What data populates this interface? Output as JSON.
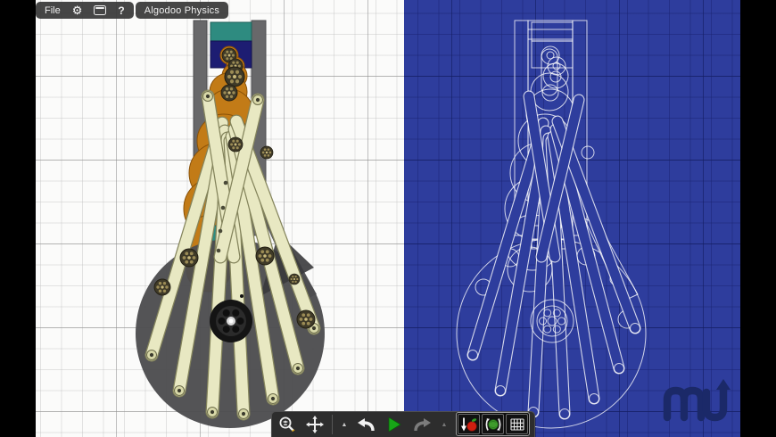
{
  "app": {
    "name": "Algodoo Physics",
    "letterbox_color": "#000000"
  },
  "top_toolbar": {
    "file_label": "File",
    "help_label": "?",
    "title": "Algodoo Physics",
    "icons": [
      {
        "name": "gear-icon",
        "meaning": "settings"
      },
      {
        "name": "window-icon",
        "meaning": "window / display options"
      }
    ]
  },
  "bottom_toolbar": {
    "tools": [
      {
        "name": "zoom-tool",
        "glyph": "magnifier-with-plus"
      },
      {
        "name": "pan-tool",
        "glyph": "four-way-arrows"
      },
      {
        "name": "undo-history",
        "glyph": "small-up-triangle",
        "enabled": true
      },
      {
        "name": "undo",
        "glyph": "curved-arrow-left",
        "enabled": true
      },
      {
        "name": "play",
        "glyph": "green-play-triangle",
        "enabled": true
      },
      {
        "name": "redo",
        "glyph": "curved-arrow-right",
        "enabled": false
      },
      {
        "name": "redo-history",
        "glyph": "small-up-triangle",
        "enabled": false
      }
    ],
    "toggles": [
      {
        "name": "gravity-toggle",
        "glyph": "apple-with-down-arrow",
        "active": true
      },
      {
        "name": "air-friction-toggle",
        "glyph": "sphere-with-wind-arcs",
        "active": true
      },
      {
        "name": "grid-toggle",
        "glyph": "grid-mesh",
        "active": true
      }
    ]
  },
  "scene": {
    "left_view": "rendered physics contraption on white grid canvas",
    "right_view": "blueprint wireframe of the same contraption on blue canvas",
    "objects": [
      "tower-rails",
      "teal-block",
      "navy-block",
      "orange-gear-stack",
      "cream-lever-fan",
      "gray-drum-circle",
      "black-flywheel",
      "small-stud-gears"
    ]
  },
  "logo": {
    "label": "mu"
  },
  "colors": {
    "canvas_bg": "#fbfbfa",
    "grid_minor": "#bdbdbd",
    "grid_major": "#8c8c8c",
    "blueprint_bg": "#2e3d9d",
    "blueprint_line": "#ffffff",
    "rail_gray": "#666668",
    "teal_block": "#2e8b80",
    "navy_block": "#1d1d72",
    "gear_orange": "#c27b17",
    "arm_cream": "#e8e8c2",
    "drum_gray": "#4d4d4f",
    "wheel_black": "#141414",
    "play_green": "#17a517",
    "apple_red": "#cf1f10",
    "logo_navy": "#1b2968"
  }
}
